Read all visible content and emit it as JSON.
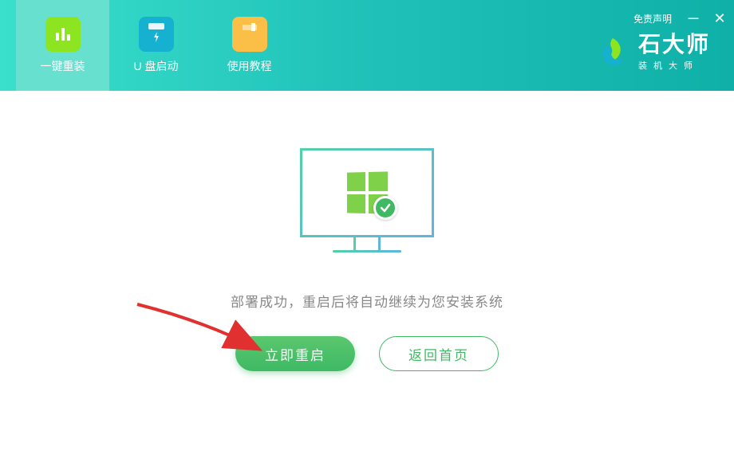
{
  "header": {
    "tabs": [
      {
        "label": "一键重装"
      },
      {
        "label": "U 盘启动"
      },
      {
        "label": "使用教程"
      }
    ],
    "disclaimer": "免责声明",
    "brand_title": "石大师",
    "brand_subtitle": "装机大师"
  },
  "main": {
    "message": "部署成功，重启后将自动继续为您安装系统",
    "primary_button": "立即重启",
    "secondary_button": "返回首页"
  }
}
